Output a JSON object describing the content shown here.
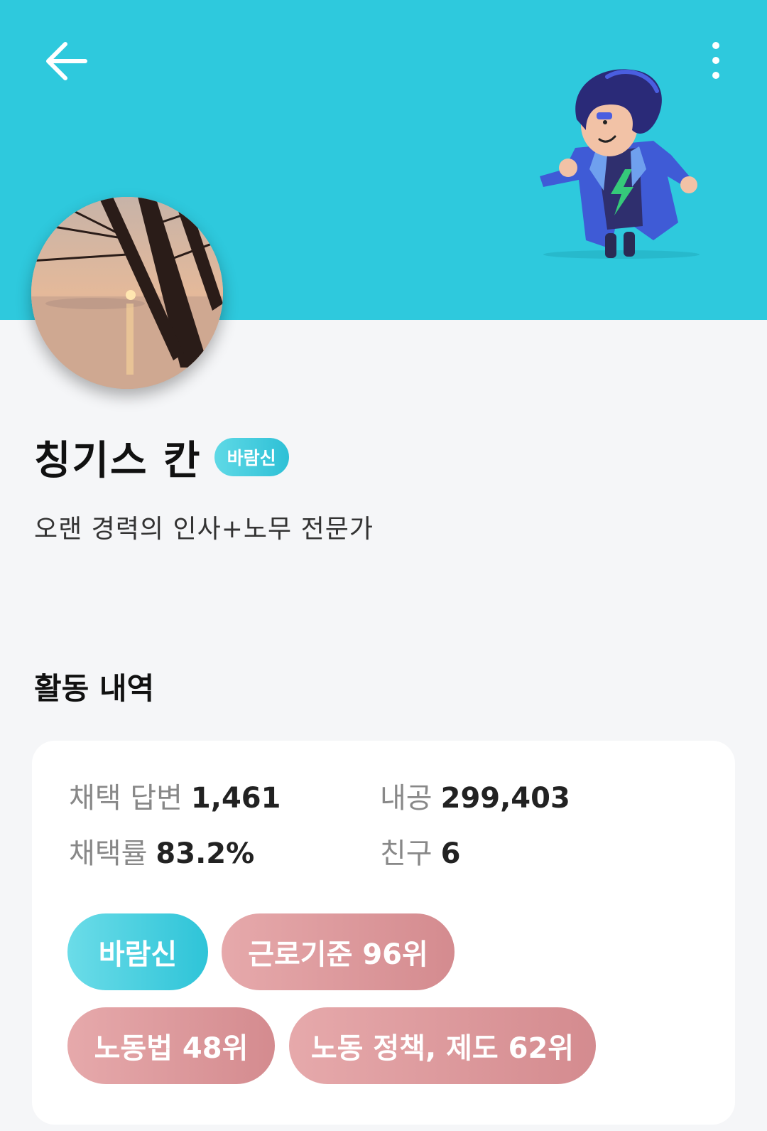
{
  "header": {
    "back_icon": "arrow-left-icon",
    "more_icon": "more-vertical-icon",
    "bg_color": "#2ec9dd"
  },
  "profile": {
    "name": "칭기스 칸",
    "grade": "바람신",
    "description": "오랜 경력의 인사+노무 전문가"
  },
  "activity": {
    "title": "활동 내역",
    "stats": [
      {
        "label": "채택 답변",
        "value": "1,461"
      },
      {
        "label": "내공",
        "value": "299,403"
      },
      {
        "label": "채택률",
        "value": "83.2%"
      },
      {
        "label": "친구",
        "value": "6"
      }
    ],
    "badges": [
      {
        "label": "바람신",
        "color": "#2ec4d8"
      },
      {
        "label": "근로기준 96위",
        "color": "#d48b8f"
      },
      {
        "label": "노동법 48위",
        "color": "#d48b8f"
      },
      {
        "label": "노동 정책, 제도 62위",
        "color": "#d48b8f"
      }
    ]
  }
}
